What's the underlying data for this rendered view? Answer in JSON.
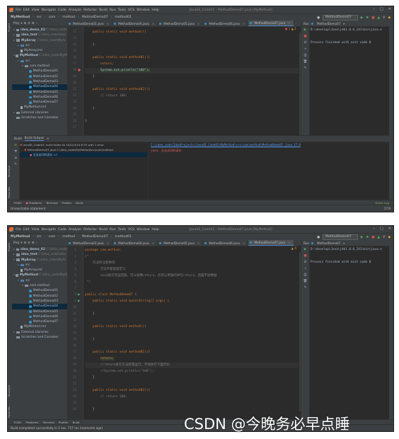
{
  "menu": {
    "items": [
      "File",
      "Edit",
      "View",
      "Navigate",
      "Code",
      "Analyze",
      "Refactor",
      "Build",
      "Run",
      "Tools",
      "VCS",
      "Window",
      "Help"
    ],
    "window_title": "JavaSE_Code01 - MethodDemo07.java [MyMethod]"
  },
  "nav": {
    "project": "MyMethod",
    "crumbs": [
      "src",
      "com",
      "method",
      "MethodDemo07",
      "method01"
    ],
    "run_config": "MethodDemo07"
  },
  "project_panel": {
    "title": "Proj",
    "tree": [
      {
        "label": "idea_demo_02",
        "hint": "C:\\idea_code\\"
      },
      {
        "label": "idea_test",
        "hint": "C:\\idea_code\\idea"
      },
      {
        "label": "MyArray",
        "hint": "C:\\idea_code\\MyAr"
      },
      {
        "label": "src"
      },
      {
        "label": "MyArray.iml"
      },
      {
        "label": "MyMethod",
        "hint": "C:\\idea_code\\MyM"
      },
      {
        "label": "src"
      },
      {
        "label": "com.method"
      },
      {
        "label": "MethodDemo01"
      },
      {
        "label": "MethodDemo02"
      },
      {
        "label": "MethodDemo03"
      },
      {
        "label": "MethodDemo04"
      },
      {
        "label": "MethodDemo05"
      },
      {
        "label": "MethodDemo06"
      },
      {
        "label": "MethodDemo07"
      },
      {
        "label": "MyMethod.iml"
      },
      {
        "label": "External Libraries"
      },
      {
        "label": "Scratches and Consoles"
      }
    ]
  },
  "tabs": [
    "MethodDemo03.java",
    "MethodDemo04.java",
    "MethodDemo05.java",
    "MethodDemo06.java",
    "MethodDemo07.java"
  ],
  "editor1": {
    "inspection_errors": "1",
    "inspection_warnings": "1",
    "lines": [
      {
        "n": "12",
        "text": "public static void method(){"
      },
      {
        "n": "13",
        "text": ""
      },
      {
        "n": "14",
        "text": "}"
      },
      {
        "n": "15",
        "text": ""
      },
      {
        "n": "16",
        "text": "public static void method01(){"
      },
      {
        "n": "17",
        "text": "return;"
      },
      {
        "n": "18",
        "text": "System.out.println(\"100\");"
      },
      {
        "n": "19",
        "text": "}"
      },
      {
        "n": "20",
        "text": ""
      },
      {
        "n": "21",
        "text": "public static void method02(){"
      },
      {
        "n": "22",
        "text": "// return 100;"
      },
      {
        "n": "23",
        "text": ""
      },
      {
        "n": "24",
        "text": "}"
      },
      {
        "n": "25",
        "text": ""
      },
      {
        "n": "26",
        "text": "}"
      },
      {
        "n": "27",
        "text": ""
      }
    ]
  },
  "editor2": {
    "inspection_warnings": "4",
    "lines": [
      {
        "n": "1",
        "text": "package com.method;"
      },
      {
        "n": "2",
        "text": "/*"
      },
      {
        "n": "3",
        "text": "方法的注意事项："
      },
      {
        "n": "4",
        "text": "方法不能嵌套定义"
      },
      {
        "n": "5",
        "text": "void表示无返回值，可以省略return，也可以单独的书写return，后面不加数据"
      },
      {
        "n": "6",
        "text": "*/"
      },
      {
        "n": "7",
        "text": ""
      },
      {
        "n": "8",
        "text": "public class MethodDemo07 {"
      },
      {
        "n": "9",
        "text": "public static void main(String[] args) {"
      },
      {
        "n": "10",
        "text": ""
      },
      {
        "n": "11",
        "text": "}"
      },
      {
        "n": "12",
        "text": ""
      },
      {
        "n": "13",
        "text": "public static void method(){"
      },
      {
        "n": "14",
        "text": ""
      },
      {
        "n": "15",
        "text": "}"
      },
      {
        "n": "16",
        "text": ""
      },
      {
        "n": "17",
        "text": "public static void method01(){"
      },
      {
        "n": "18",
        "text": "return;"
      },
      {
        "n": "19",
        "text": "//return表示方法结束运行，不会执行下面代码"
      },
      {
        "n": "20",
        "text": "//System.out.println(\"100\");"
      },
      {
        "n": "21",
        "text": "}"
      },
      {
        "n": "22",
        "text": ""
      },
      {
        "n": "23",
        "text": "public static void method02(){"
      },
      {
        "n": "24",
        "text": "// return 100;"
      },
      {
        "n": "25",
        "text": ""
      },
      {
        "n": "26",
        "text": "}"
      }
    ]
  },
  "run_panel": {
    "label": "Run",
    "tab": "MethodDemo07",
    "cmd": "D:\\develop\\Java\\jdk1.8.0_241\\bin\\java.e",
    "result": "Process finished with exit code 0"
  },
  "build": {
    "tabs": [
      "Build",
      "Build Output"
    ],
    "tree": [
      "JavaSE_Code01: build failed At 2022/4/10 6:35 with 1 error",
      "MethodDemo07.java C:\\idea_code\\MyMethod\\src\\com\\method",
      "无法访问的语句 :17"
    ],
    "path": "C:\\idea_code\\IdeaProjects\\JavaSE_Code01\\MyMethod\\src\\com\\method\\MethodDemo07.java:17:9",
    "msg_label": "java:",
    "msg": "无法访问的语句"
  },
  "bottom_tabs": [
    "TODO",
    "Problems",
    "Terminal",
    "Profiler",
    "Build"
  ],
  "event_log": "Event Log",
  "status1": {
    "text": "Unreachable statement",
    "pos": "17:9"
  },
  "status2": {
    "text": "Build completed successfully in 2 sec, 717 ms (moments ago)"
  },
  "watermark": "CSDN @今晚务必早点睡"
}
